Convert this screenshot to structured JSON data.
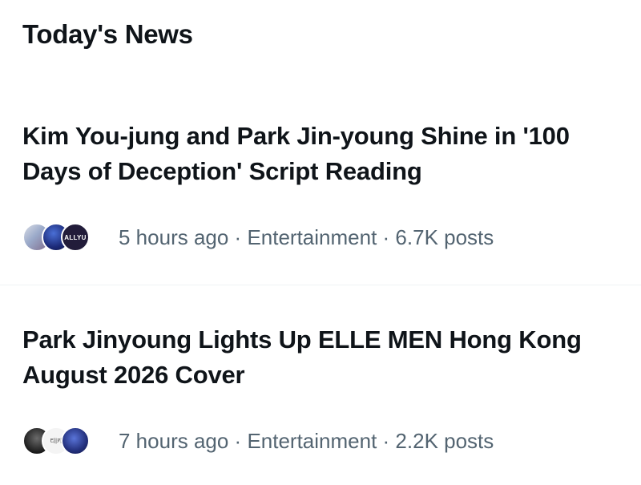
{
  "section": {
    "title": "Today's News"
  },
  "stories": [
    {
      "headline": "Kim You-jung and Park Jin-young Shine in '100 Days of Deception' Script Reading",
      "time": "5 hours ago",
      "category": "Entertainment",
      "posts": "6.7K posts",
      "avatar_badges": [
        "",
        "",
        "ALLYU"
      ]
    },
    {
      "headline": "Park Jinyoung Lights Up ELLE MEN Hong Kong August 2026 Cover",
      "time": "7 hours ago",
      "category": "Entertainment",
      "posts": "2.2K posts",
      "avatar_badges": [
        "",
        "티|키",
        ""
      ]
    }
  ],
  "separator": " · ",
  "colors": {
    "text_primary": "#0f1419",
    "text_secondary": "#536471",
    "divider": "#eff3f4"
  }
}
